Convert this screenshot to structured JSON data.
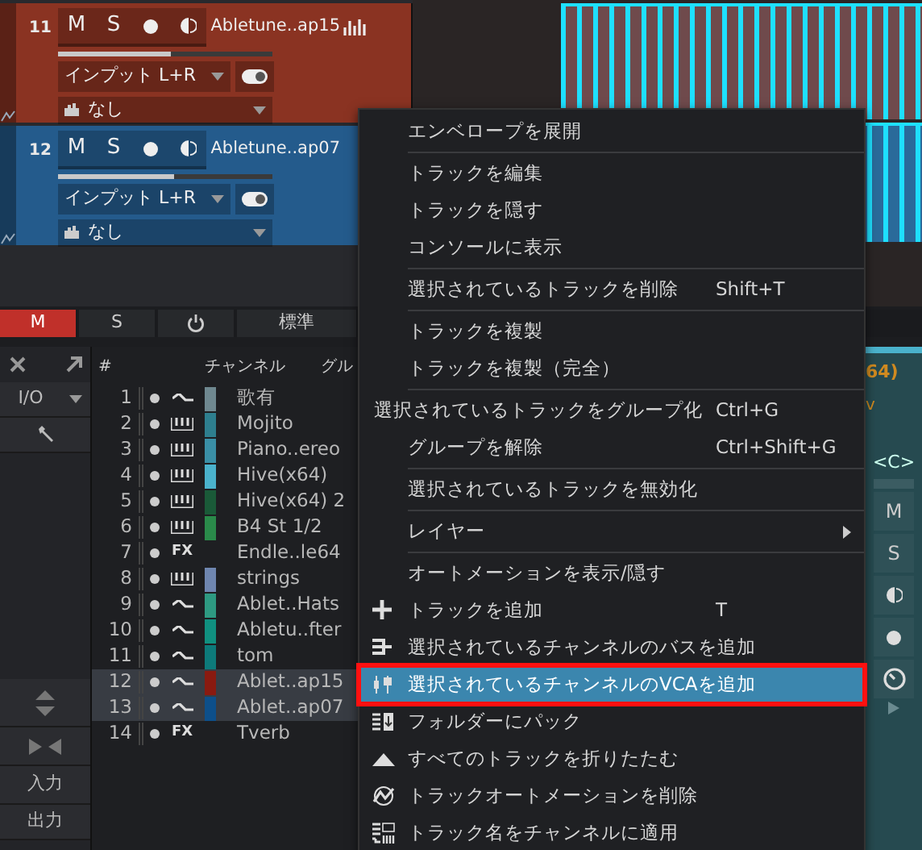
{
  "tracks": [
    {
      "number": "11",
      "buttons": [
        "M",
        "S"
      ],
      "name": "Abletune..ap15",
      "color": "#8a3322",
      "waveform": true,
      "level": 0.53,
      "input": "インプット L+R",
      "output": "なし",
      "selected": false
    },
    {
      "number": "12",
      "buttons": [
        "M",
        "S"
      ],
      "name": "Abletune..ap07",
      "color": "#245b8c",
      "waveform": false,
      "level": 0.54,
      "input": "インプット L+R",
      "output": "なし",
      "selected": false
    }
  ],
  "footer_buttons": [
    {
      "label": "M",
      "kind": "text",
      "on": true
    },
    {
      "label": "S",
      "kind": "text",
      "on": false
    },
    {
      "kind": "power",
      "on": false
    },
    {
      "label": "標準",
      "kind": "text",
      "on": false
    }
  ],
  "sidebar": {
    "io_label": "I/O",
    "input_label": "入力",
    "output_label": "出力"
  },
  "channel_list": {
    "columns": [
      "#",
      "チャンネル",
      "グル"
    ],
    "rows": [
      {
        "number": "1",
        "kind": "audio",
        "color": "#6f8890",
        "name": "歌有",
        "selected": false
      },
      {
        "number": "2",
        "kind": "instrument",
        "color": "#2e7f8f",
        "name": "Mojito",
        "selected": false
      },
      {
        "number": "3",
        "kind": "instrument",
        "color": "#3a8fa6",
        "name": "Piano..ereo",
        "selected": false
      },
      {
        "number": "4",
        "kind": "instrument",
        "color": "#4ab2cc",
        "name": "Hive(x64)",
        "selected": false
      },
      {
        "number": "5",
        "kind": "instrument",
        "color": "#1a5a38",
        "name": "Hive(x64) 2",
        "selected": false
      },
      {
        "number": "6",
        "kind": "instrument",
        "color": "#2a8a4a",
        "name": "B4 St 1/2",
        "selected": false
      },
      {
        "number": "7",
        "kind": "fx",
        "fx_label": "FX",
        "name": "Endle..le64",
        "selected": false
      },
      {
        "number": "8",
        "kind": "instrument",
        "color": "#6f86b0",
        "name": "strings",
        "selected": false
      },
      {
        "number": "9",
        "kind": "audio",
        "color": "#2e9a82",
        "name": "Ablet..Hats",
        "selected": false
      },
      {
        "number": "10",
        "kind": "audio",
        "color": "#109080",
        "name": "Abletu..fter",
        "selected": false
      },
      {
        "number": "11",
        "kind": "audio",
        "color": "#0d7a7a",
        "name": "tom",
        "selected": false
      },
      {
        "number": "12",
        "kind": "audio",
        "color": "#8a1a10",
        "name": "Ablet..ap15",
        "selected": true
      },
      {
        "number": "13",
        "kind": "audio",
        "color": "#0d4f8a",
        "name": "Ablet..ap07",
        "selected": true
      },
      {
        "number": "14",
        "kind": "fx",
        "fx_label": "FX",
        "name": "Tverb",
        "selected": false
      }
    ]
  },
  "mixer_strip": {
    "name_fragment": "64)",
    "insert_fragment": "v",
    "pan": "<C>",
    "buttons": [
      "M",
      "S"
    ]
  },
  "context_menu": [
    {
      "label": "エンベロープを展開",
      "selected": false,
      "separator_after": true
    },
    {
      "label": "トラックを編集",
      "selected": false,
      "separator_after": false
    },
    {
      "label": "トラックを隠す",
      "selected": false,
      "separator_after": false
    },
    {
      "label": "コンソールに表示",
      "selected": false,
      "separator_after": true
    },
    {
      "label": "選択されているトラックを削除",
      "shortcut": "Shift+T",
      "selected": false,
      "separator_after": true
    },
    {
      "label": "トラックを複製",
      "selected": false,
      "separator_after": false
    },
    {
      "label": "トラックを複製（完全）",
      "selected": false,
      "separator_after": true
    },
    {
      "label": "選択されているトラックをグループ化",
      "shortcut": "Ctrl+G",
      "selected": false,
      "separator_after": false
    },
    {
      "label": "グループを解除",
      "shortcut": "Ctrl+Shift+G",
      "selected": false,
      "separator_after": true
    },
    {
      "label": "選択されているトラックを無効化",
      "selected": false,
      "separator_after": true
    },
    {
      "label": "レイヤー",
      "submenu": true,
      "selected": false,
      "separator_after": true
    },
    {
      "label": "オートメーションを表示/隠す",
      "selected": false,
      "separator_after": false
    },
    {
      "label": "トラックを追加",
      "shortcut": "T",
      "kind": "plus",
      "selected": false,
      "separator_after": false
    },
    {
      "label": "選択されているチャンネルのバスを追加",
      "kind": "bus",
      "selected": false,
      "separator_after": false
    },
    {
      "label": "選択されているチャンネルのVCAを追加",
      "kind": "vca",
      "selected": true,
      "separator_after": false
    },
    {
      "label": "フォルダーにパック",
      "kind": "folder",
      "selected": false,
      "separator_after": false
    },
    {
      "label": "すべてのトラックを折りたたむ",
      "kind": "collapse",
      "selected": false,
      "separator_after": false
    },
    {
      "label": "トラックオートメーションを削除",
      "kind": "automation",
      "selected": false,
      "separator_after": false
    },
    {
      "label": "トラック名をチャンネルに適用",
      "kind": "names",
      "selected": false,
      "separator_after": false
    }
  ]
}
